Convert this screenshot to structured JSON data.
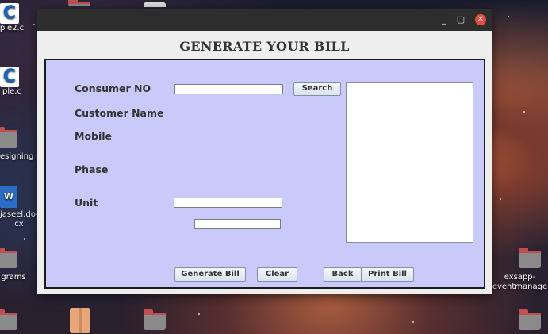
{
  "desktop": {
    "icons": [
      {
        "label": "ple2.c"
      },
      {
        "label": "ple.c"
      },
      {
        "label": "esigning"
      },
      {
        "label": "jaseel.do-\ncx"
      },
      {
        "label": "grams"
      },
      {
        "label": "exsapp-\neventmanage"
      }
    ]
  },
  "window": {
    "controls": {
      "minimize": "_",
      "maximize": "▢",
      "close": "✕"
    },
    "app_title": "GENERATE YOUR BILL",
    "form": {
      "consumer_no_label": "Consumer NO",
      "consumer_no_value": "",
      "search_label": "Search",
      "customer_name_label": "Customer Name",
      "mobile_label": "Mobile",
      "phase_label": "Phase",
      "unit_label": "Unit",
      "unit_value": "",
      "extra_value": "",
      "bill_preview_value": ""
    },
    "buttons": {
      "generate_bill": "Generate Bill",
      "clear": "Clear",
      "back": "Back",
      "print_bill": "Print Bill"
    }
  }
}
